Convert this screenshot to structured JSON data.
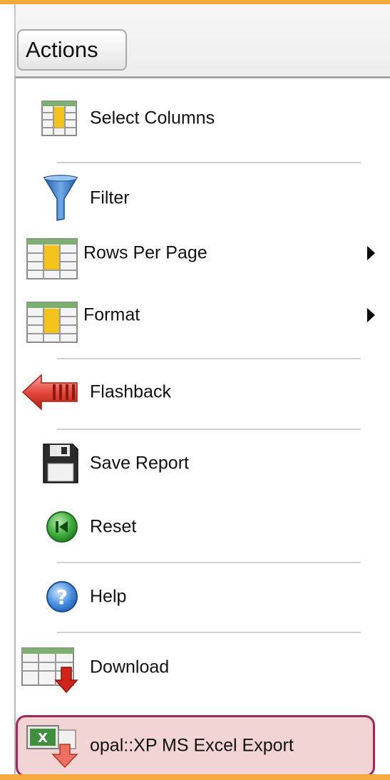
{
  "toolbar": {
    "actions_label": "Actions"
  },
  "menu": {
    "items": [
      {
        "label": "Select Columns",
        "icon": "table-columns-icon",
        "submenu": false
      },
      {
        "label": "Filter",
        "icon": "funnel-icon",
        "submenu": false
      },
      {
        "label": "Rows Per Page",
        "icon": "table-rows-icon",
        "submenu": true
      },
      {
        "label": "Format",
        "icon": "table-format-icon",
        "submenu": true
      },
      {
        "label": "Flashback",
        "icon": "red-arrow-left-icon",
        "submenu": false
      },
      {
        "label": "Save Report",
        "icon": "floppy-disk-icon",
        "submenu": false
      },
      {
        "label": "Reset",
        "icon": "green-reset-icon",
        "submenu": false
      },
      {
        "label": "Help",
        "icon": "question-mark-icon",
        "submenu": false
      },
      {
        "label": "Download",
        "icon": "table-download-icon",
        "submenu": false
      },
      {
        "label": "opal::XP MS Excel Export",
        "icon": "excel-export-icon",
        "submenu": false,
        "highlighted": true
      }
    ]
  },
  "colors": {
    "frame_orange": "#f6a93e",
    "highlight_border": "#a0285a",
    "highlight_fill": "#f2d4d4"
  }
}
